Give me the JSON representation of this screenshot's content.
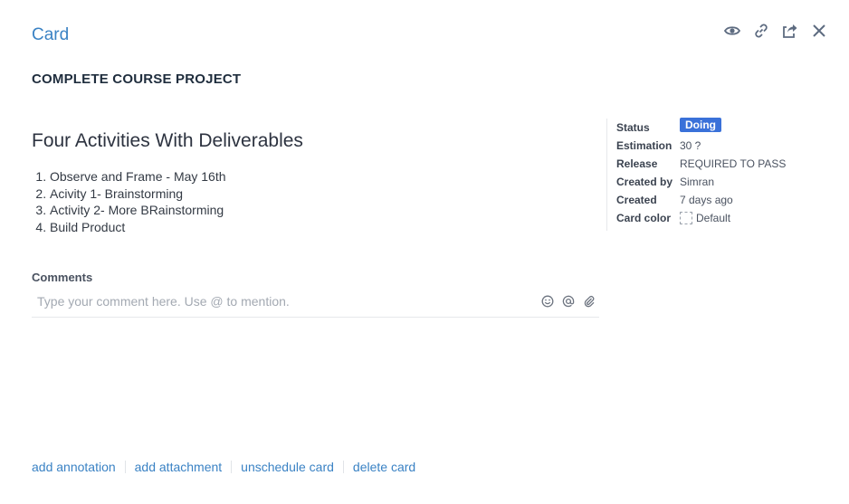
{
  "header": {
    "card_label": "Card",
    "icons": [
      "eye-icon",
      "link-icon",
      "share-icon",
      "close-icon"
    ]
  },
  "card": {
    "title": "COMPLETE COURSE PROJECT",
    "description_heading": "Four Activities With Deliverables",
    "description_items": [
      "Observe and Frame - May 16th",
      "Acivity 1- Brainstorming",
      "Activity 2- More BRainstorming",
      "Build Product"
    ]
  },
  "meta": {
    "status_label": "Status",
    "status_value": "Doing",
    "estimation_label": "Estimation",
    "estimation_value": "30 ?",
    "release_label": "Release",
    "release_value": "REQUIRED TO PASS",
    "created_by_label": "Created by",
    "created_by_value": "Simran",
    "created_label": "Created",
    "created_value": "7 days ago",
    "card_color_label": "Card color",
    "card_color_value": "Default",
    "status_color": "#3a71d9"
  },
  "comments": {
    "label": "Comments",
    "placeholder": "Type your comment here. Use @ to mention.",
    "tools": [
      "emoji-icon",
      "mention-icon",
      "attach-icon"
    ]
  },
  "footer": {
    "add_annotation": "add annotation",
    "add_attachment": "add attachment",
    "unschedule_card": "unschedule card",
    "delete_card": "delete card"
  },
  "colors": {
    "accent": "#3a82c4"
  }
}
